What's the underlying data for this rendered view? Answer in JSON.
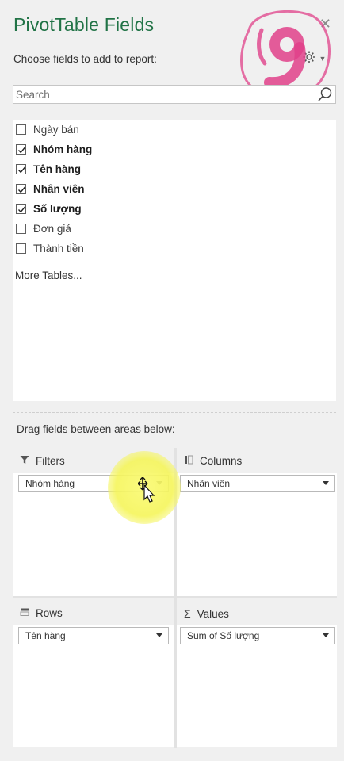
{
  "pane": {
    "title": "PivotTable Fields",
    "subtitle": "Choose fields to add to report:",
    "close_icon": "close-icon",
    "tools_icon": "gear-icon"
  },
  "search": {
    "placeholder": "Search",
    "value": ""
  },
  "fields": [
    {
      "label": "Ngày bán",
      "checked": false
    },
    {
      "label": "Nhóm hàng",
      "checked": true
    },
    {
      "label": "Tên hàng",
      "checked": true
    },
    {
      "label": "Nhân viên",
      "checked": true
    },
    {
      "label": "Số lượng",
      "checked": true
    },
    {
      "label": "Đơn giá",
      "checked": false
    },
    {
      "label": "Thành tiền",
      "checked": false
    }
  ],
  "more_tables": "More Tables...",
  "areas_label": "Drag fields between areas below:",
  "areas": {
    "filters": {
      "label": "Filters",
      "items": [
        "Nhóm hàng"
      ]
    },
    "columns": {
      "label": "Columns",
      "items": [
        "Nhân viên"
      ]
    },
    "rows": {
      "label": "Rows",
      "items": [
        "Tên hàng"
      ]
    },
    "values": {
      "label": "Values",
      "items": [
        "Sum of Số lượng"
      ]
    }
  },
  "colors": {
    "title": "#217346",
    "logo": "#e0418a",
    "highlight": "#f5f55a"
  }
}
